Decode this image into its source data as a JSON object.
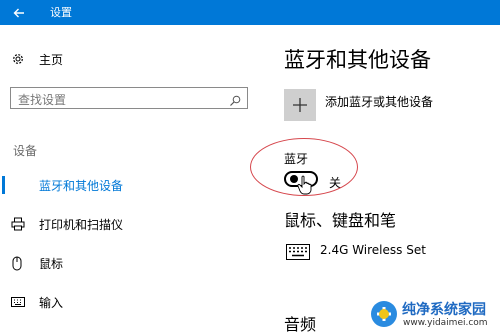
{
  "window": {
    "title": "设置"
  },
  "sidebar": {
    "home_label": "主页",
    "search_placeholder": "查找设置",
    "section_label": "设备",
    "items": [
      {
        "label": "蓝牙和其他设备",
        "active": true,
        "icon": "bluetooth-icon"
      },
      {
        "label": "打印机和扫描仪",
        "active": false,
        "icon": "printer-icon"
      },
      {
        "label": "鼠标",
        "active": false,
        "icon": "mouse-icon"
      },
      {
        "label": "输入",
        "active": false,
        "icon": "keyboard-icon"
      }
    ]
  },
  "main": {
    "heading": "蓝牙和其他设备",
    "add_device_label": "添加蓝牙或其他设备",
    "bluetooth": {
      "label": "蓝牙",
      "state_label": "关",
      "on": false
    },
    "mouse_keyboard_heading": "鼠标、键盘和笔",
    "devices": [
      {
        "name": "2.4G Wireless Set",
        "icon": "keyboard-icon"
      }
    ],
    "audio_heading": "音频"
  },
  "colors": {
    "accent": "#0078d7",
    "annotation": "#d6474d"
  },
  "watermark": {
    "title": "纯净系统家园",
    "url": "www.yidaimei.com"
  }
}
